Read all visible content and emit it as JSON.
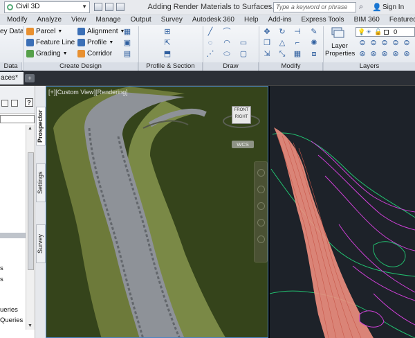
{
  "titlebar": {
    "workspace": "Civil 3D",
    "document_title": "Adding Render Materials to Surfaces.dwg",
    "search_placeholder": "Type a keyword or phrase",
    "signin": "Sign In"
  },
  "ribbon_tabs": [
    "Modify",
    "Analyze",
    "View",
    "Manage",
    "Output",
    "Survey",
    "Autodesk 360",
    "Help",
    "Add-ins",
    "Express Tools",
    "BIM 360",
    "Featured Apps"
  ],
  "ribbon": {
    "ground_data_label": "ey Data",
    "ground_data_panel": "Data",
    "create_design": {
      "parcel": "Parcel",
      "feature_line": "Feature Line",
      "grading": "Grading",
      "alignment": "Alignment",
      "profile": "Profile",
      "corridor": "Corridor",
      "panel": "Create Design"
    },
    "profile_section_panel": "Profile & Section Views",
    "draw_panel": "Draw",
    "modify_panel": "Modify",
    "layer_properties_line1": "Layer",
    "layer_properties_line2": "Properties",
    "layer_value": "0",
    "layers_panel": "Layers"
  },
  "doc_tab": {
    "label": "aces*"
  },
  "toolspace": {
    "item_ueries": "ueries",
    "item_queries": "Queries",
    "item_s1": "s",
    "item_s2": "s",
    "tabs": [
      "Prospector",
      "Settings",
      "Survey"
    ]
  },
  "viewport": {
    "label": "[+][Custom View][Rendering]",
    "cube_text": "FRONT",
    "cube_side": "RIGHT",
    "wcs": "WCS"
  },
  "colors": {
    "terrain": "#35441b",
    "road_surface": "#8e9298",
    "contour_fill": "#f08f7f",
    "contour_magenta": "#d040d8",
    "contour_green": "#22c070",
    "viewport_border": "#4d86c8"
  }
}
